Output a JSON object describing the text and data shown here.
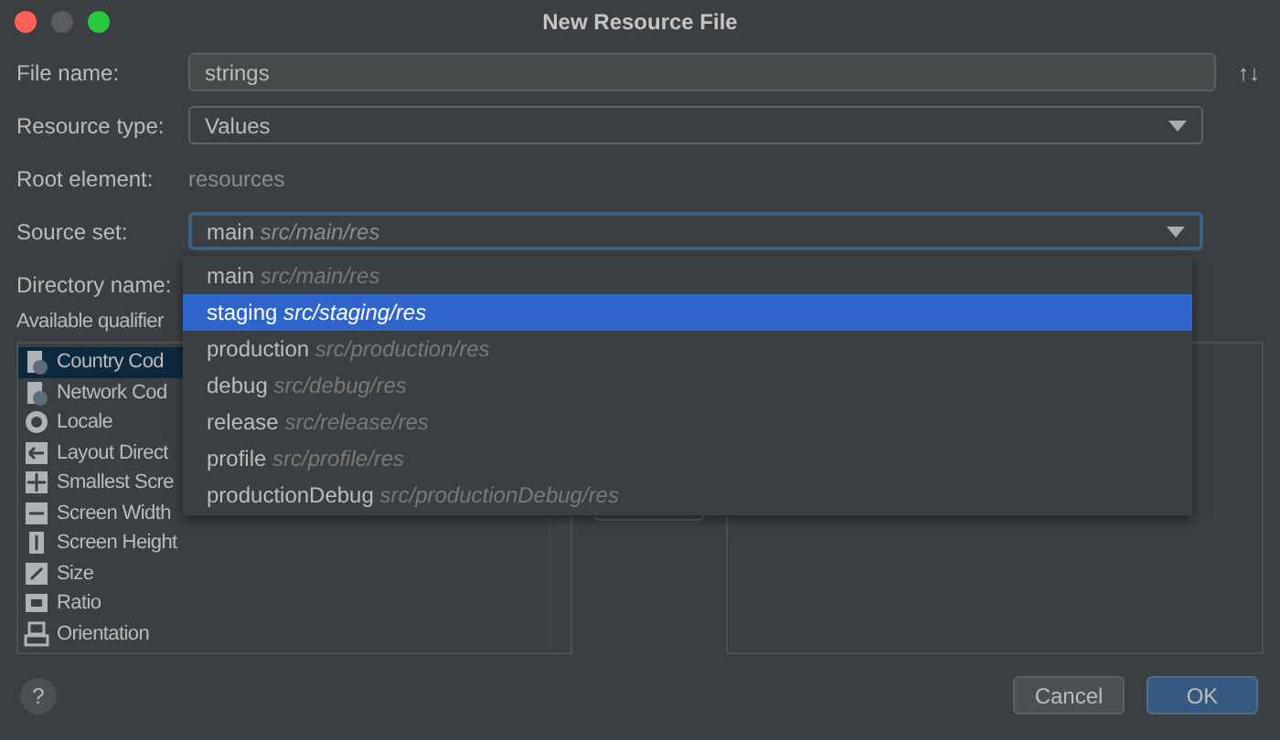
{
  "window": {
    "title": "New Resource File"
  },
  "form": [
    {
      "kind": "text",
      "label": "File name:",
      "value": "strings"
    },
    {
      "kind": "select",
      "label": "Resource type:",
      "value": "Values"
    },
    {
      "kind": "static",
      "label": "Root element:",
      "value": "resources"
    },
    {
      "kind": "select_focused",
      "label": "Source set:",
      "value": "main",
      "hint": "src/main/res"
    },
    {
      "kind": "label",
      "label": "Directory name:"
    }
  ],
  "qualifiers_label": "Available qualifier",
  "qualifiers": [
    {
      "label": "Country Cod",
      "selected": true
    },
    {
      "label": "Network Cod",
      "selected": false
    },
    {
      "label": "Locale",
      "selected": false
    },
    {
      "label": "Layout Direct",
      "selected": false
    },
    {
      "label": "Smallest Scre",
      "selected": false
    },
    {
      "label": "Screen Width",
      "selected": false
    },
    {
      "label": "Screen Height",
      "selected": false
    },
    {
      "label": "Size",
      "selected": false
    },
    {
      "label": "Ratio",
      "selected": false
    },
    {
      "label": "Orientation",
      "selected": false
    }
  ],
  "sort_icon": "↑↓",
  "dropdown": [
    {
      "name": "main",
      "path": "src/main/res",
      "selected": false
    },
    {
      "name": "staging",
      "path": "src/staging/res",
      "selected": true
    },
    {
      "name": "production",
      "path": "src/production/res",
      "selected": false
    },
    {
      "name": "debug",
      "path": "src/debug/res",
      "selected": false
    },
    {
      "name": "release",
      "path": "src/release/res",
      "selected": false
    },
    {
      "name": "profile",
      "path": "src/profile/res",
      "selected": false
    },
    {
      "name": "productionDebug",
      "path": "src/productionDebug/res",
      "selected": false
    }
  ],
  "help": "?",
  "buttons": [
    {
      "label": "Cancel",
      "kind": "secondary"
    },
    {
      "label": "OK",
      "kind": "primary"
    }
  ]
}
